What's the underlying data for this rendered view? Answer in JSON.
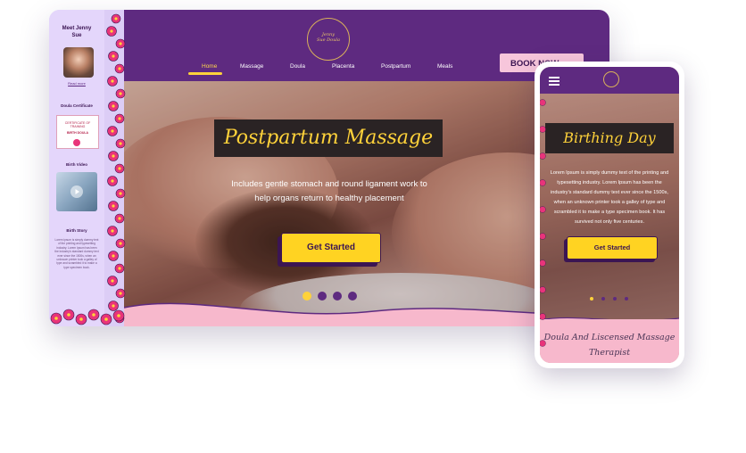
{
  "desktop": {
    "sidebar": {
      "meet_heading": "Meet Jenny Sue",
      "read_more": "Read more",
      "cert_heading": "Doula Certificate",
      "cert_line1": "CERTIFICATE OF TRAINING",
      "cert_line2": "BIRTH DOULA",
      "video_heading": "Birth Video",
      "story_heading": "Birth Story",
      "story_text": "Lorem ipsum is simply dummy text of the printing and typesetting industry. Lorem Ipsum has been the industry's standard dummy text ever since the 1500s, when an unknown printer took a galley of type and scrambled it to make a type specimen book."
    },
    "logo": {
      "line1": "Jenny",
      "line2": "Sue Doula"
    },
    "nav": [
      "Home",
      "Massage",
      "Doula",
      "Placenta",
      "Postpartum",
      "Meals"
    ],
    "book_button": "BOOK NOW",
    "hero": {
      "title": "Postpartum Massage",
      "subtitle": "Includes gentle stomach and round ligament work to help organs return to healthy placement",
      "cta": "Get Started",
      "slides": 4,
      "active_slide": 1
    }
  },
  "mobile": {
    "hero": {
      "title": "Birthing Day",
      "text": "Lorem Ipsum is simply dummy text of the printing and typesetting industry. Lorem Ipsum has been the industry's standard dummy text ever since the 1500s, when an unknown printer took a galley of type and scrambled it to make a type specimen book. It has survived not only five centuries.",
      "cta": "Get Started",
      "slides": 4,
      "active_slide": 1
    },
    "footer_title": "Doula And Liscensed Massage Therapist"
  },
  "colors": {
    "purple": "#5e2a80",
    "gold": "#ffd23a",
    "pink": "#f7b8cc",
    "lavender": "#e4d6fb",
    "flower": "#e8347a"
  },
  "icons": [
    "flower-border-icon",
    "hamburger-menu-icon",
    "play-icon",
    "logo-emblem-icon"
  ]
}
